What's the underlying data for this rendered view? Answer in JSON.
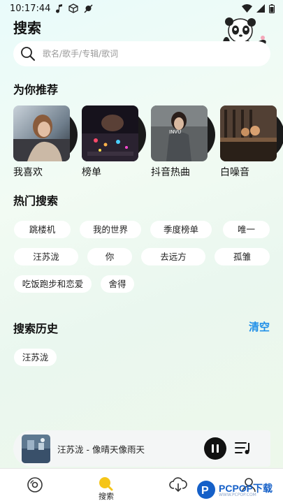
{
  "status_bar": {
    "time": "10:17:44"
  },
  "page_title": "搜索",
  "search": {
    "placeholder": "歌名/歌手/专辑/歌词"
  },
  "recommend": {
    "title": "为你推荐",
    "items": [
      {
        "label": "我喜欢"
      },
      {
        "label": "榜单"
      },
      {
        "label": "抖音热曲"
      },
      {
        "label": "白噪音"
      }
    ]
  },
  "hot": {
    "title": "热门搜索",
    "chips": [
      "跳楼机",
      "我的世界",
      "季度榜单",
      "唯一",
      "汪苏泷",
      "你",
      "去远方",
      "孤雏",
      "吃饭跑步和恋爱",
      "舍得"
    ]
  },
  "history": {
    "title": "搜索历史",
    "clear_label": "清空",
    "chips": [
      "汪苏泷"
    ]
  },
  "player": {
    "title": "汪苏泷 - 像晴天像雨天"
  },
  "tabs": [
    {
      "icon": "disc-icon",
      "label": ""
    },
    {
      "icon": "search-icon",
      "label": "搜索"
    },
    {
      "icon": "cloud-download-icon",
      "label": ""
    },
    {
      "icon": "user-icon",
      "label": ""
    }
  ],
  "watermark": {
    "main": "PCPOP下载",
    "sub": "WWW.PCPOP.COM"
  },
  "colors": {
    "accent": "#1f8fe8",
    "active_tab": "#f5c518"
  }
}
